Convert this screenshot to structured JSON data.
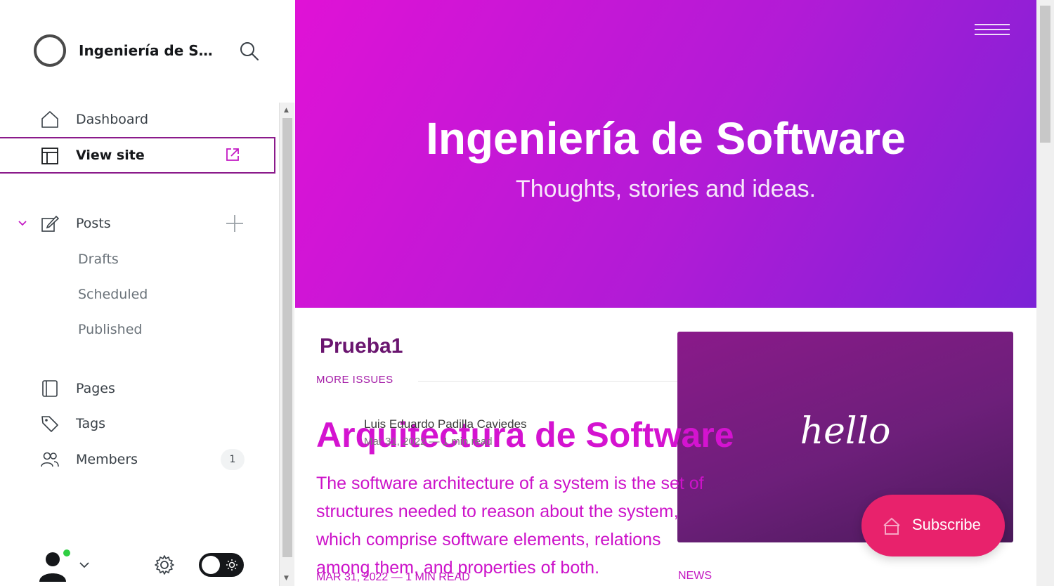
{
  "sidebar": {
    "site_name": "Ingeniería de So...",
    "nav": {
      "dashboard": "Dashboard",
      "view_site": "View site",
      "posts": "Posts",
      "drafts": "Drafts",
      "scheduled": "Scheduled",
      "published": "Published",
      "pages": "Pages",
      "tags": "Tags",
      "members": "Members",
      "members_count": "1"
    },
    "footer": {
      "online_color": "#30cf43"
    }
  },
  "preview": {
    "hero": {
      "title": "Ingeniería de Software",
      "subtitle": "Thoughts, stories and ideas.",
      "gradient": [
        "#e012d6",
        "#7b22d6"
      ]
    },
    "post_small_title": "Prueba1",
    "more_issues": "MORE ISSUES",
    "author_name": "Luis Eduardo Padilla Caviedes",
    "author_date": "Mar 31, 2022 — 1 min read",
    "article": {
      "title": "Arquitectura de Software",
      "excerpt": "The software architecture of a system is the set of structures needed to reason about the system, which comprise software elements, relations among them, and properties of both.",
      "meta": "MAR 31, 2022 — 1 MIN READ",
      "tag": "NEWS",
      "image_text": "hello"
    },
    "subscribe_label": "Subscribe",
    "accent_color": "#e8226c"
  }
}
